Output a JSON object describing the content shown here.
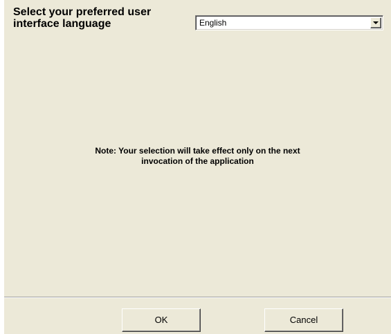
{
  "language_prompt": {
    "label": "Select your preferred user interface language"
  },
  "language_select": {
    "selected_value": "English",
    "icon": "chevron-down-icon"
  },
  "note": {
    "line1": "Note: Your selection will take effect only on the next",
    "line2": "invocation of the application"
  },
  "buttons": {
    "ok_label": "OK",
    "cancel_label": "Cancel"
  },
  "colors": {
    "dialog_background": "#ece9d8",
    "field_background": "#ffffff"
  }
}
